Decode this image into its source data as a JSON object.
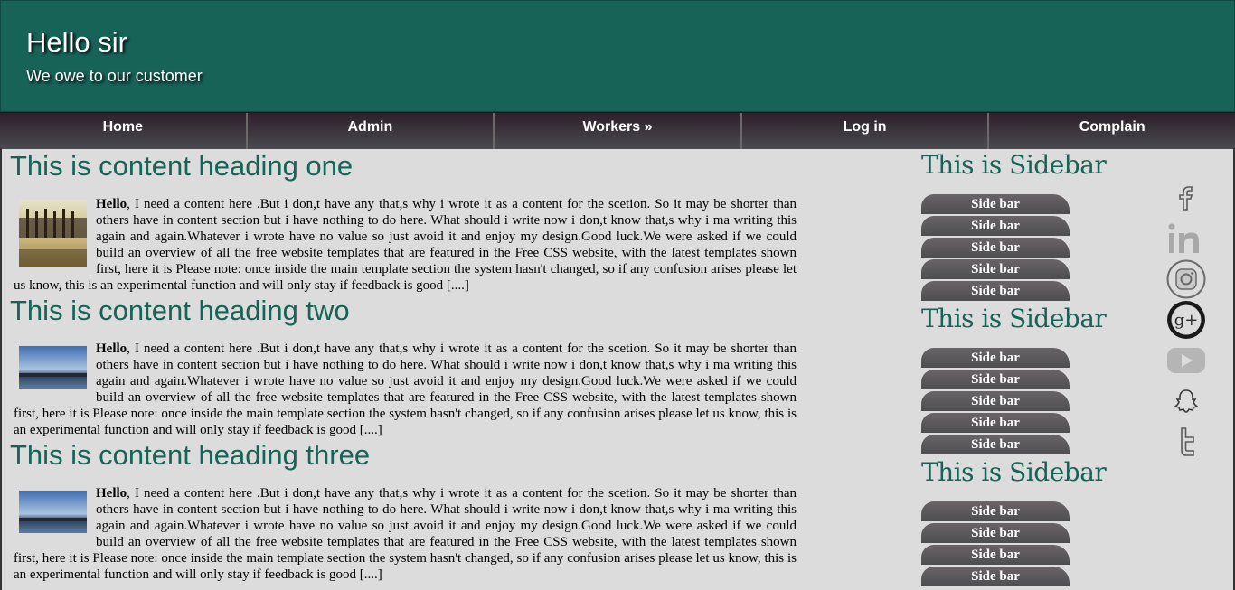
{
  "header": {
    "title": "Hello sir",
    "tagline": "We owe to our customer"
  },
  "nav": [
    "Home",
    "Admin",
    "Workers »",
    "Log in",
    "Complain"
  ],
  "articles": [
    {
      "heading": "This is content heading one",
      "bold": "Hello",
      "text": ", I need a content here .But i don,t have any that,s why i wrote it as a content for the scetion. So it may be shorter than others have in content section but i have nothing to do here. What should i write now i don,t know that,s why i ma writing this again and again.Whatever i wrote have no value so just avoid it and enjoy my design.Good luck.We were asked if we could build an overview of all the free website templates that are featured in the Free CSS website, with the latest templates shown first, here it is Please note: once inside the main template section the system hasn't changed, so if any confusion arises please let us know, this is an experimental function and will only stay if feedback is good [....]"
    },
    {
      "heading": "This is content heading two",
      "bold": "Hello",
      "text": ", I need a content here .But i don,t have any that,s why i wrote it as a content for the scetion. So it may be shorter than others have in content section but i have nothing to do here. What should i write now i don,t know that,s why i ma writing this again and again.Whatever i wrote have no value so just avoid it and enjoy my design.Good luck.We were asked if we could build an overview of all the free website templates that are featured in the Free CSS website, with the latest templates shown first, here it is Please note: once inside the main template section the system hasn't changed, so if any confusion arises please let us know, this is an experimental function and will only stay if feedback is good [....]"
    },
    {
      "heading": "This is content heading three",
      "bold": "Hello",
      "text": ", I need a content here .But i don,t have any that,s why i wrote it as a content for the scetion. So it may be shorter than others have in content section but i have nothing to do here. What should i write now i don,t know that,s why i ma writing this again and again.Whatever i wrote have no value so just avoid it and enjoy my design.Good luck.We were asked if we could build an overview of all the free website templates that are featured in the Free CSS website, with the latest templates shown first, here it is Please note: once inside the main template section the system hasn't changed, so if any confusion arises please let us know, this is an experimental function and will only stay if feedback is good [....]"
    }
  ],
  "sidebar": {
    "sections": [
      {
        "heading": "This is Sidebar",
        "items": [
          "Side bar",
          "Side bar",
          "Side bar",
          "Side bar",
          "Side bar"
        ]
      },
      {
        "heading": "This is Sidebar",
        "items": [
          "Side bar",
          "Side bar",
          "Side bar",
          "Side bar",
          "Side bar"
        ]
      },
      {
        "heading": "This is Sidebar",
        "items": [
          "Side bar",
          "Side bar",
          "Side bar",
          "Side bar"
        ]
      }
    ]
  },
  "social_icons": [
    "facebook-icon",
    "linkedin-icon",
    "instagram-icon",
    "google-plus-icon",
    "youtube-icon",
    "snapchat-icon",
    "twitter-icon"
  ],
  "colors": {
    "accent": "#186358",
    "nav": "#3a2f3a"
  }
}
